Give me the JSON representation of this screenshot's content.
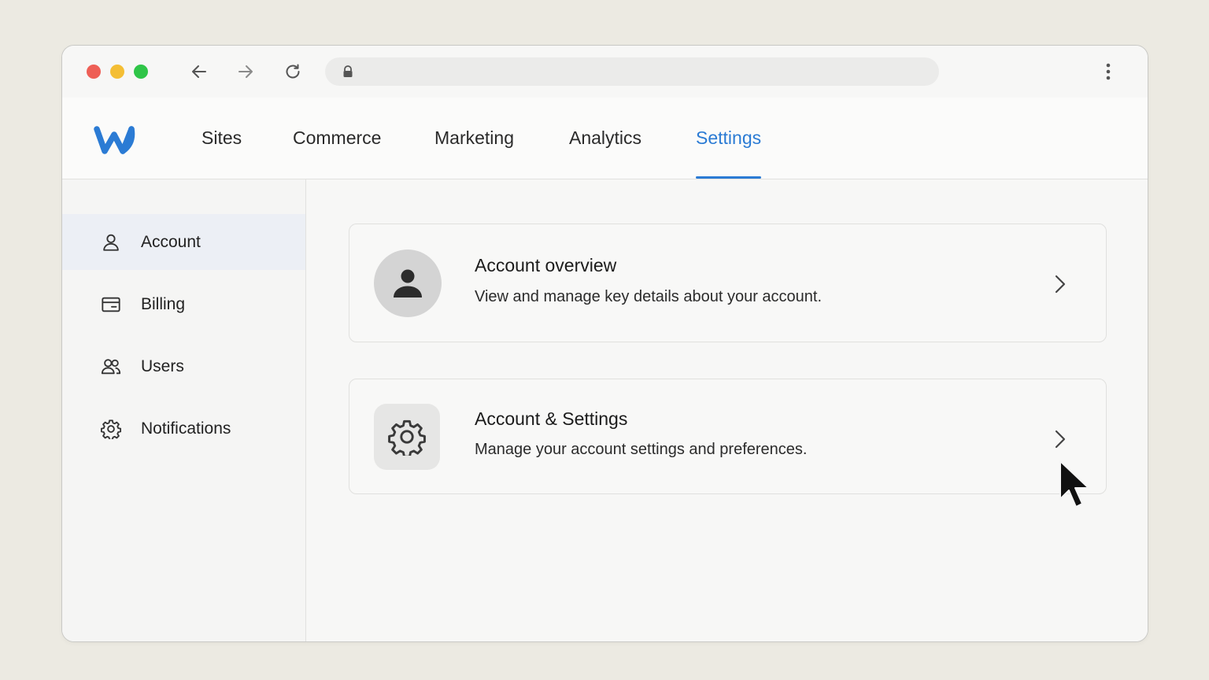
{
  "browser": {
    "back_icon": "arrow-left-icon",
    "forward_icon": "arrow-right-icon",
    "reload_icon": "reload-icon",
    "lock_icon": "lock-icon",
    "url": "",
    "menu_icon": "kebab-menu-icon"
  },
  "app": {
    "logo": "weebly-w-logo",
    "brand_color": "#2b7bd4"
  },
  "top_nav": {
    "tabs": [
      {
        "label": "Sites"
      },
      {
        "label": "Commerce"
      },
      {
        "label": "Marketing"
      },
      {
        "label": "Analytics"
      },
      {
        "label": "Settings",
        "active": true
      }
    ]
  },
  "sidebar": {
    "items": [
      {
        "label": "Account",
        "icon": "person-icon",
        "active": true
      },
      {
        "label": "Billing",
        "icon": "card-icon"
      },
      {
        "label": "Users",
        "icon": "users-icon"
      },
      {
        "label": "Notifications",
        "icon": "gear-icon"
      }
    ]
  },
  "main": {
    "cards": [
      {
        "title": "Account overview",
        "description": "View and manage key details about your account.",
        "icon": "avatar-icon"
      },
      {
        "title": "Account & Settings",
        "description": "Manage your account settings and preferences.",
        "icon": "gear-icon"
      }
    ]
  }
}
